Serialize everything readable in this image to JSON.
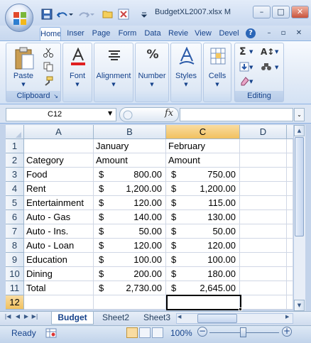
{
  "window": {
    "title": "BudgetXL2007.xlsx  M",
    "minimize": "–",
    "maximize": "□",
    "close": "✕"
  },
  "ribbon_tabs": [
    "Home",
    "Inser",
    "Page",
    "Form",
    "Data",
    "Revie",
    "View",
    "Devel"
  ],
  "ribbon_controls": {
    "help": "?",
    "min": "–",
    "restore": "▫",
    "close": "✕"
  },
  "ribbon_groups": {
    "clipboard": {
      "label": "Clipboard",
      "paste": "Paste"
    },
    "font": {
      "label": "Font"
    },
    "alignment": {
      "label": "Alignment"
    },
    "number": {
      "label": "Number"
    },
    "styles": {
      "label": "Styles"
    },
    "cells": {
      "label": "Cells"
    },
    "editing": {
      "label": "Editing"
    }
  },
  "formula_bar": {
    "name_box": "C12",
    "fx": "fx",
    "value": ""
  },
  "columns": [
    "A",
    "B",
    "C",
    "D"
  ],
  "rows": [
    {
      "n": "1",
      "a": "",
      "b_cur": "",
      "b": "January",
      "c_cur": "",
      "c": "February"
    },
    {
      "n": "2",
      "a": "Category",
      "b_cur": "",
      "b": "Amount",
      "c_cur": "",
      "c": "Amount"
    },
    {
      "n": "3",
      "a": "Food",
      "b_cur": "$",
      "b": "800.00",
      "c_cur": "$",
      "c": "750.00"
    },
    {
      "n": "4",
      "a": "Rent",
      "b_cur": "$",
      "b": "1,200.00",
      "c_cur": "$",
      "c": "1,200.00"
    },
    {
      "n": "5",
      "a": "Entertainment",
      "b_cur": "$",
      "b": "120.00",
      "c_cur": "$",
      "c": "115.00"
    },
    {
      "n": "6",
      "a": "Auto - Gas",
      "b_cur": "$",
      "b": "140.00",
      "c_cur": "$",
      "c": "130.00"
    },
    {
      "n": "7",
      "a": "Auto - Ins.",
      "b_cur": "$",
      "b": "50.00",
      "c_cur": "$",
      "c": "50.00"
    },
    {
      "n": "8",
      "a": "Auto - Loan",
      "b_cur": "$",
      "b": "120.00",
      "c_cur": "$",
      "c": "120.00"
    },
    {
      "n": "9",
      "a": "Education",
      "b_cur": "$",
      "b": "100.00",
      "c_cur": "$",
      "c": "100.00"
    },
    {
      "n": "10",
      "a": "Dining",
      "b_cur": "$",
      "b": "200.00",
      "c_cur": "$",
      "c": "180.00"
    },
    {
      "n": "11",
      "a": "Total",
      "b_cur": "$",
      "b": "2,730.00",
      "c_cur": "$",
      "c": "2,645.00"
    },
    {
      "n": "12",
      "a": "",
      "b_cur": "",
      "b": "",
      "c_cur": "",
      "c": ""
    }
  ],
  "sheets": [
    "Budget",
    "Sheet2",
    "Sheet3"
  ],
  "status": {
    "ready": "Ready",
    "zoom": "100%",
    "zoom_out": "−",
    "zoom_in": "+"
  },
  "colors": {
    "accent": "#15428b",
    "selection_header": "#f1c15f",
    "office_button": "#9bb3d6"
  }
}
